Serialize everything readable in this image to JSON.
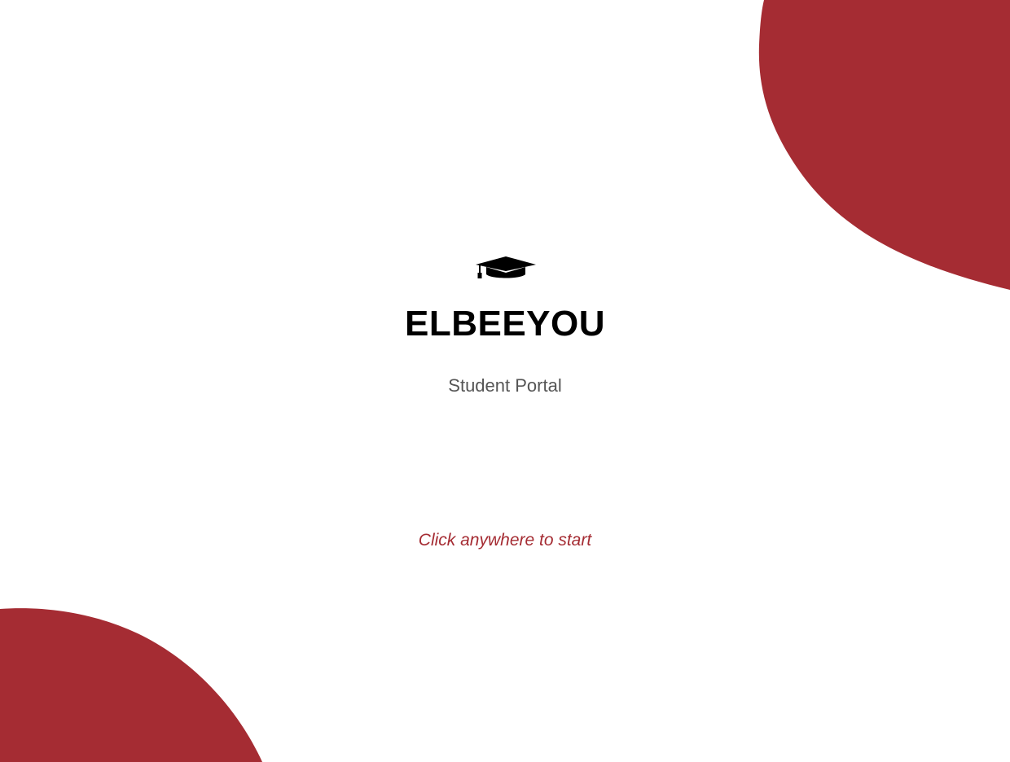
{
  "app": {
    "title": "ELBEEYOU",
    "subtitle": "Student Portal",
    "start_hint": "Click anywhere to start",
    "logo_icon": "graduation-cap-icon"
  },
  "colors": {
    "accent": "#a52c33",
    "background": "#ffffff",
    "title": "#000000",
    "subtitle": "#555555"
  }
}
